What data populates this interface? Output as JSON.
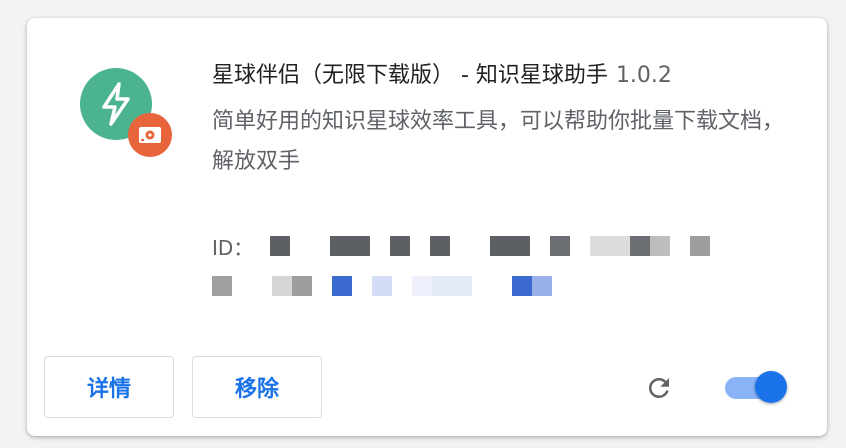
{
  "extension": {
    "name": "星球伴侣（无限下载版） - 知识星球助手",
    "version": "1.0.2",
    "description": "简单好用的知识星球效率工具，可以帮助你批量下载文档，解放双手",
    "id_label": "ID："
  },
  "buttons": {
    "details_label": "详情",
    "remove_label": "移除"
  },
  "toggle": {
    "enabled": true
  },
  "colors": {
    "icon_main": "#4cb38f",
    "icon_badge": "#e8643b",
    "accent": "#1a73e8",
    "toggle_track": "#8ab4f8",
    "toggle_knob": "#1a73e8",
    "reload_icon": "#5f6368"
  },
  "icons": {
    "main": "lightning-icon",
    "badge": "hard-drive-icon",
    "reload": "reload-icon"
  }
}
